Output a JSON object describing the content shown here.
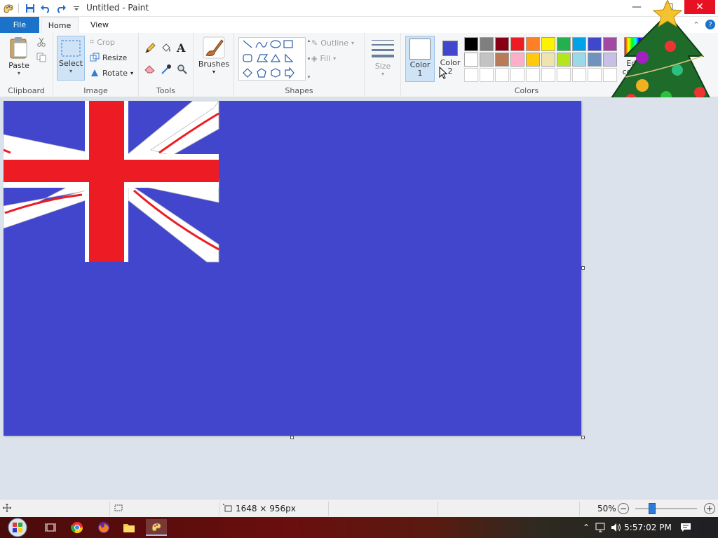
{
  "window": {
    "title": "Untitled - Paint",
    "minimize_icon": "minimize-icon",
    "maximize_icon": "maximize-icon",
    "close_icon": "close-icon"
  },
  "menu": {
    "file": "File",
    "tabs": [
      "Home",
      "View"
    ]
  },
  "ribbon": {
    "clipboard": {
      "paste": "Paste",
      "group": "Clipboard"
    },
    "image": {
      "select": "Select",
      "crop": "Crop",
      "resize": "Resize",
      "rotate": "Rotate",
      "group": "Image"
    },
    "tools": {
      "group": "Tools"
    },
    "brushes": {
      "label": "Brushes"
    },
    "shapes": {
      "outline": "Outline",
      "fill": "Fill",
      "group": "Shapes"
    },
    "size": {
      "label": "Size"
    },
    "colors": {
      "color1_label": "Color 1",
      "color2_label": "Color 2",
      "edit_label": "Edit colors",
      "group": "Colors",
      "color1_value": "#ffffff",
      "color2_value": "#4146cd",
      "palette_row1": [
        "#000000",
        "#7f7f7f",
        "#880015",
        "#ed1c24",
        "#ff7f27",
        "#fff200",
        "#22b14c",
        "#00a2e8",
        "#3f48cc",
        "#a349a4"
      ],
      "palette_row2": [
        "#ffffff",
        "#c3c3c3",
        "#b97a57",
        "#ffaec9",
        "#ffc90e",
        "#efe4b0",
        "#b5e61d",
        "#99d9ea",
        "#7092be",
        "#c8bfe7"
      ]
    }
  },
  "canvas": {
    "background": "#4146cd",
    "flag_red": "#ed1c24"
  },
  "status": {
    "dimensions": "1648 × 956px",
    "zoom": "50%",
    "zoom_level": 0.5
  },
  "taskbar": {
    "time": "5:57:02 PM"
  }
}
